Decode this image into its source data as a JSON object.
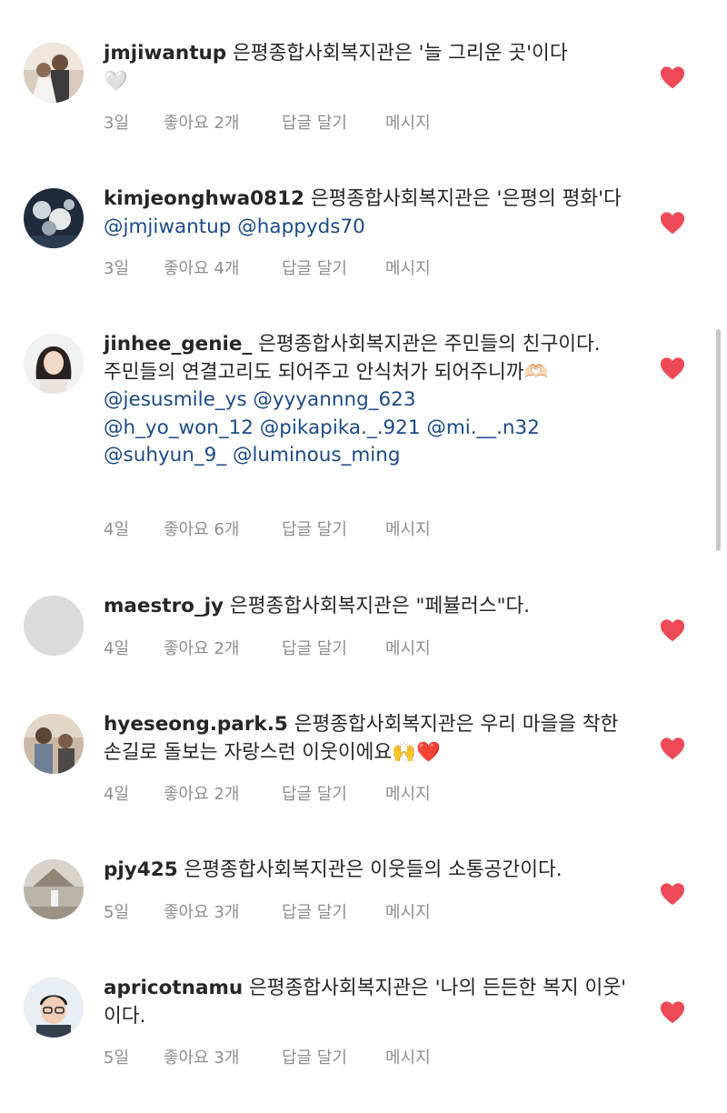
{
  "comments": [
    {
      "username": "jmjiwantup",
      "text": "은평종합사회복지관은 '늘 그리운 곳'이다",
      "extra": "🤍",
      "time": "3일",
      "likes": "좋아요 2개",
      "reply": "답글 달기",
      "message": "메시지",
      "liked": true
    },
    {
      "username": "kimjeonghwa0812",
      "text": "은평종합사회복지관은 '은평의 평화'다",
      "mentions": "@jmjiwantup @happyds70",
      "time": "3일",
      "likes": "좋아요 4개",
      "reply": "답글 달기",
      "message": "메시지",
      "liked": true
    },
    {
      "username": "jinhee_genie_",
      "text": "은평종합사회복지관은 주민들의 친구이다.\n주민들의 연결고리도 되어주고 안식처가 되어주니까🫶🏻",
      "mentions": "@jesusmile_ys @yyyannng_623\n@h_yo_won_12 @pikapika._.921 @mi.__.n32\n@suhyun_9_ @luminous_ming",
      "time": "4일",
      "likes": "좋아요 6개",
      "reply": "답글 달기",
      "message": "메시지",
      "liked": true
    },
    {
      "username": "maestro_jy",
      "text": "은평종합사회복지관은 \"페뷸러스\"다.",
      "time": "4일",
      "likes": "좋아요 2개",
      "reply": "답글 달기",
      "message": "메시지",
      "liked": true
    },
    {
      "username": "hyeseong.park.5",
      "text": "은평종합사회복지관은 우리 마을을 착한 손길로 돌보는 자랑스런 이웃이에요🙌❤️",
      "time": "4일",
      "likes": "좋아요 2개",
      "reply": "답글 달기",
      "message": "메시지",
      "liked": true
    },
    {
      "username": "pjy425",
      "text": "은평종합사회복지관은 이웃들의 소통공간이다.",
      "time": "5일",
      "likes": "좋아요 3개",
      "reply": "답글 달기",
      "message": "메시지",
      "liked": true
    },
    {
      "username": "apricotnamu",
      "text": "은평종합사회복지관은 '나의 든든한 복지 이웃' 이다.",
      "time": "5일",
      "likes": "좋아요 3개",
      "reply": "답글 달기",
      "message": "메시지",
      "liked": true
    }
  ],
  "icons": {
    "like": "heart-icon"
  },
  "colors": {
    "heart": "#ed4956",
    "mention": "#1a4a86",
    "meta": "#8e8e8e"
  }
}
